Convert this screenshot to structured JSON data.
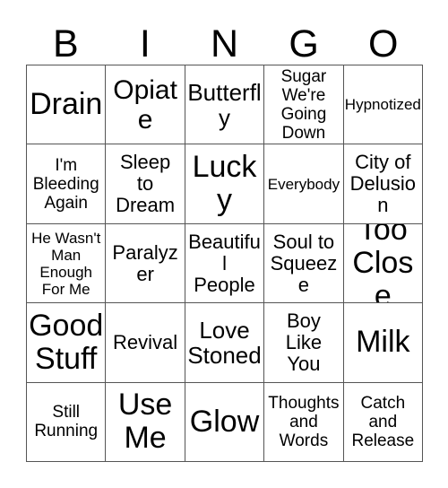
{
  "card": {
    "title": "BINGO",
    "header_letters": [
      "B",
      "I",
      "N",
      "G",
      "O"
    ],
    "grid_size": "5x5",
    "colors": {
      "background": "#ffffff",
      "text": "#000000",
      "border": "#555555"
    },
    "rows": [
      [
        {
          "text": "Drain",
          "size": "xxl"
        },
        {
          "text": "Opiate",
          "size": "xl"
        },
        {
          "text": "Butterfly",
          "size": "lg"
        },
        {
          "text": "Sugar\nWe're\nGoing\nDown",
          "size": "sm"
        },
        {
          "text": "Hypnotized",
          "size": "xs"
        }
      ],
      [
        {
          "text": "I'm\nBleeding\nAgain",
          "size": "sm"
        },
        {
          "text": "Sleep\nto\nDream",
          "size": "md"
        },
        {
          "text": "Lucky",
          "size": "xxl"
        },
        {
          "text": "Everybody",
          "size": "xs"
        },
        {
          "text": "City of\nDelusion",
          "size": "md"
        }
      ],
      [
        {
          "text": "He Wasn't\nMan\nEnough\nFor Me",
          "size": "xs"
        },
        {
          "text": "Paralyzer",
          "size": "md"
        },
        {
          "text": "Beautiful\nPeople",
          "size": "md"
        },
        {
          "text": "Soul to\nSqueeze",
          "size": "md"
        },
        {
          "text": "Too\nClose",
          "size": "xxl"
        }
      ],
      [
        {
          "text": "Good\nStuff",
          "size": "xxl"
        },
        {
          "text": "Revival",
          "size": "md"
        },
        {
          "text": "Love\nStoned",
          "size": "lg"
        },
        {
          "text": "Boy\nLike\nYou",
          "size": "md"
        },
        {
          "text": "Milk",
          "size": "xxl"
        }
      ],
      [
        {
          "text": "Still\nRunning",
          "size": "sm"
        },
        {
          "text": "Use\nMe",
          "size": "xxl"
        },
        {
          "text": "Glow",
          "size": "xxl"
        },
        {
          "text": "Thoughts\nand\nWords",
          "size": "sm"
        },
        {
          "text": "Catch\nand\nRelease",
          "size": "sm"
        }
      ]
    ]
  }
}
